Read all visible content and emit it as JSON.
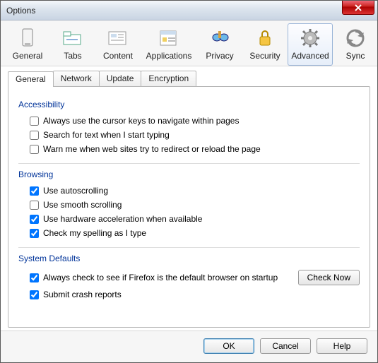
{
  "window": {
    "title": "Options"
  },
  "toolbar": {
    "general": "General",
    "tabs": "Tabs",
    "content": "Content",
    "applications": "Applications",
    "privacy": "Privacy",
    "security": "Security",
    "advanced": "Advanced",
    "sync": "Sync",
    "selected": "advanced"
  },
  "subtabs": {
    "general": "General",
    "network": "Network",
    "update": "Update",
    "encryption": "Encryption",
    "active": "general"
  },
  "groups": {
    "accessibility": {
      "title": "Accessibility",
      "cursor_keys": {
        "label": "Always use the cursor keys to navigate within pages",
        "checked": false
      },
      "search_text": {
        "label": "Search for text when I start typing",
        "checked": false
      },
      "warn_redirect": {
        "label": "Warn me when web sites try to redirect or reload the page",
        "checked": false
      }
    },
    "browsing": {
      "title": "Browsing",
      "autoscroll": {
        "label": "Use autoscrolling",
        "checked": true
      },
      "smooth": {
        "label": "Use smooth scrolling",
        "checked": false
      },
      "hwaccel": {
        "label": "Use hardware acceleration when available",
        "checked": true
      },
      "spelling": {
        "label": "Check my spelling as I type",
        "checked": true
      }
    },
    "system": {
      "title": "System Defaults",
      "default_browser": {
        "label": "Always check to see if Firefox is the default browser on startup",
        "checked": true
      },
      "crash": {
        "label": "Submit crash reports",
        "checked": true
      },
      "check_now": "Check Now"
    }
  },
  "footer": {
    "ok": "OK",
    "cancel": "Cancel",
    "help": "Help"
  }
}
